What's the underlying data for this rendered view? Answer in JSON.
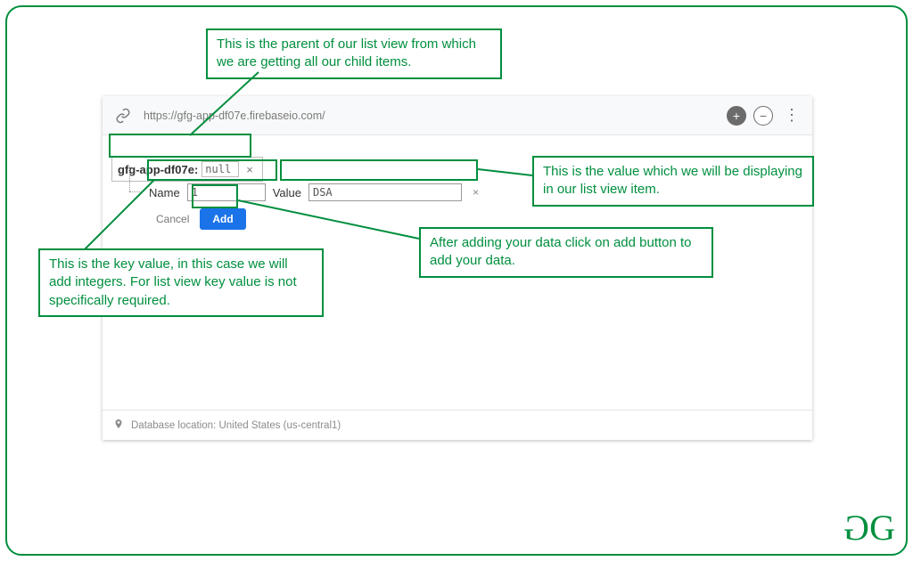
{
  "header": {
    "url": "https://gfg-app-df07e.firebaseio.com/"
  },
  "node": {
    "label": "gfg-app-df07e:",
    "null_value": "null"
  },
  "fields": {
    "name_label": "Name",
    "name_value": "1",
    "value_label": "Value",
    "value_value": "DSA"
  },
  "actions": {
    "cancel": "Cancel",
    "add": "Add"
  },
  "footer": {
    "location": "Database location: United States (us-central1)"
  },
  "annotations": {
    "parent": "This is the parent of our list view from which we are getting all our child items.",
    "value_desc": "This is the value which we will be displaying in our list view item.",
    "add_desc": "After adding your data click on add button to add your data.",
    "key_desc": "This is the key value, in this case we will add integers. For list view key value is not specifically required."
  },
  "icons": {
    "plus": "+",
    "minus": "−",
    "dots": "⋮",
    "link": "🔗",
    "pin": "📍",
    "close": "×"
  },
  "logo": {
    "g1": "G",
    "g2": "G"
  }
}
